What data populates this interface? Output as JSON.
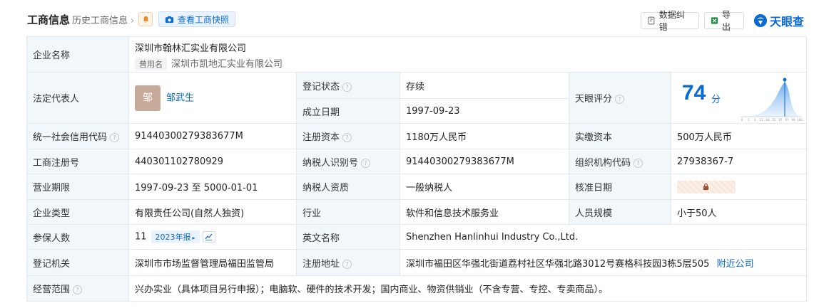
{
  "header": {
    "title": "工商信息",
    "history": "历史工商信息",
    "snapshot": "查看工商快照",
    "feedback": "数据纠错",
    "export": "导出",
    "logo": "天眼查"
  },
  "rows": {
    "company_name_label": "企业名称",
    "company_name": "深圳市翰林汇实业有限公司",
    "former_tag": "曾用名",
    "former_name": "深圳市凯地汇实业有限公司",
    "legal_rep_label": "法定代表人",
    "legal_rep_avatar": "邹",
    "legal_rep": "邹武生",
    "reg_status_label": "登记状态",
    "reg_status": "存续",
    "est_date_label": "成立日期",
    "est_date": "1997-09-23",
    "score_label": "天眼评分",
    "score": "74",
    "score_unit": "分",
    "credit_code_label": "统一社会信用代码",
    "credit_code": "91440300279383677M",
    "reg_capital_label": "注册资本",
    "reg_capital": "1180万人民币",
    "paid_capital_label": "实缴资本",
    "paid_capital": "500万人民币",
    "reg_no_label": "工商注册号",
    "reg_no": "440301102780929",
    "tax_id_label": "纳税人识别号",
    "tax_id": "91440300279383677M",
    "org_code_label": "组织机构代码",
    "org_code": "27938367-7",
    "period_label": "营业期限",
    "period": "1997-09-23 至 5000-01-01",
    "tax_qual_label": "纳税人资质",
    "tax_qual": "一般纳税人",
    "approve_date_label": "核准日期",
    "type_label": "企业类型",
    "type": "有限责任公司(自然人独资)",
    "industry_label": "行业",
    "industry": "软件和信息技术服务业",
    "staff_label": "人员规模",
    "staff": "小于50人",
    "insured_label": "参保人数",
    "insured": "11",
    "insured_report": "2023年报",
    "en_name_label": "英文名称",
    "en_name": "Shenzhen Hanlinhui Industry Co.,Ltd.",
    "authority_label": "登记机关",
    "authority": "深圳市市场监督管理局福田监管局",
    "address_label": "注册地址",
    "address": "深圳市福田区华强北街道荔村社区华强北路3012号赛格科技园3栋5层505",
    "nearby": "附近公司",
    "scope_label": "经营范围",
    "scope": "兴办实业（具体项目另行申报）；电脑软、硬件的技术开发；国内商业、物资供销业（不含专营、专控、专卖商品）。"
  },
  "score_chart": {
    "ticks": [
      "0",
      "1",
      "3",
      "11",
      "18",
      "55",
      "87",
      "97",
      "99",
      "100"
    ],
    "accent": "#0a6ad4"
  }
}
